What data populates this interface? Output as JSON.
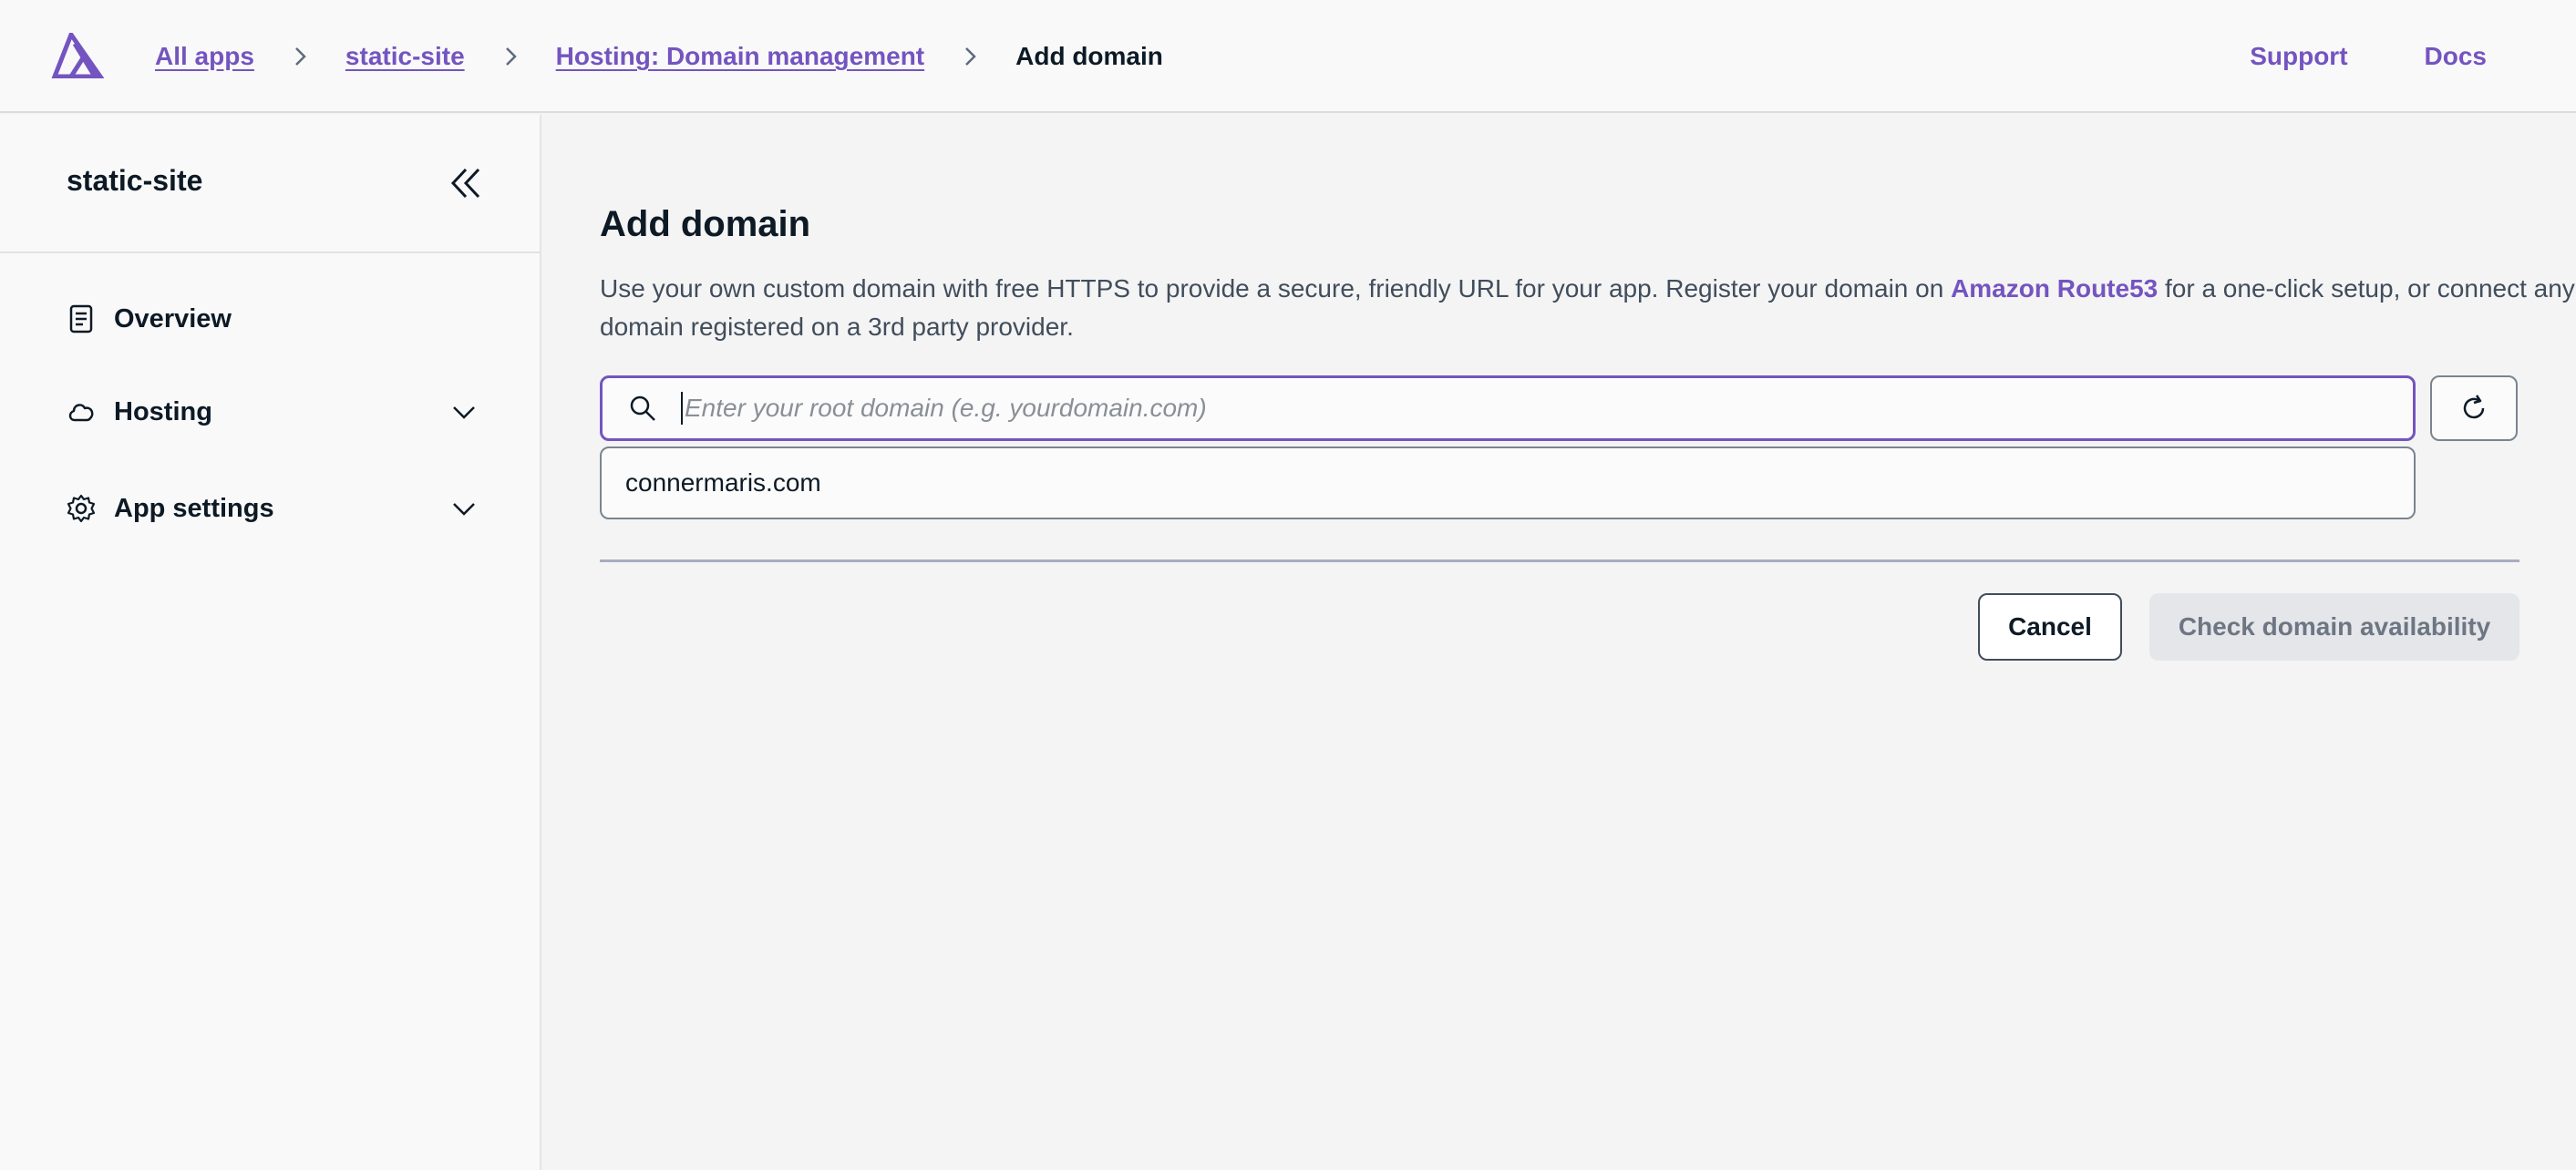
{
  "header": {
    "breadcrumbs": [
      {
        "label": "All apps"
      },
      {
        "label": "static-site"
      },
      {
        "label": "Hosting: Domain management"
      }
    ],
    "current": "Add domain",
    "links": {
      "support": "Support",
      "docs": "Docs"
    }
  },
  "sidebar": {
    "app_name": "static-site",
    "items": [
      {
        "label": "Overview",
        "icon": "document-icon"
      },
      {
        "label": "Hosting",
        "icon": "cloud-icon",
        "expandable": true
      },
      {
        "label": "App settings",
        "icon": "gear-icon",
        "expandable": true
      }
    ]
  },
  "main": {
    "title": "Add domain",
    "description_before": "Use your own custom domain with free HTTPS to provide a secure, friendly URL for your app. Register your domain on ",
    "description_link": "Amazon Route53",
    "description_after": " for a one-click setup, or connect any domain registered on a 3rd party provider.",
    "search": {
      "placeholder": "Enter your root domain (e.g. yourdomain.com)",
      "value": ""
    },
    "suggestion": "connermaris.com",
    "cancel_label": "Cancel",
    "check_label": "Check domain availability"
  },
  "colors": {
    "accent": "#7454c0",
    "text": "#0d1a26",
    "disabled_bg": "#e4e6ea"
  }
}
